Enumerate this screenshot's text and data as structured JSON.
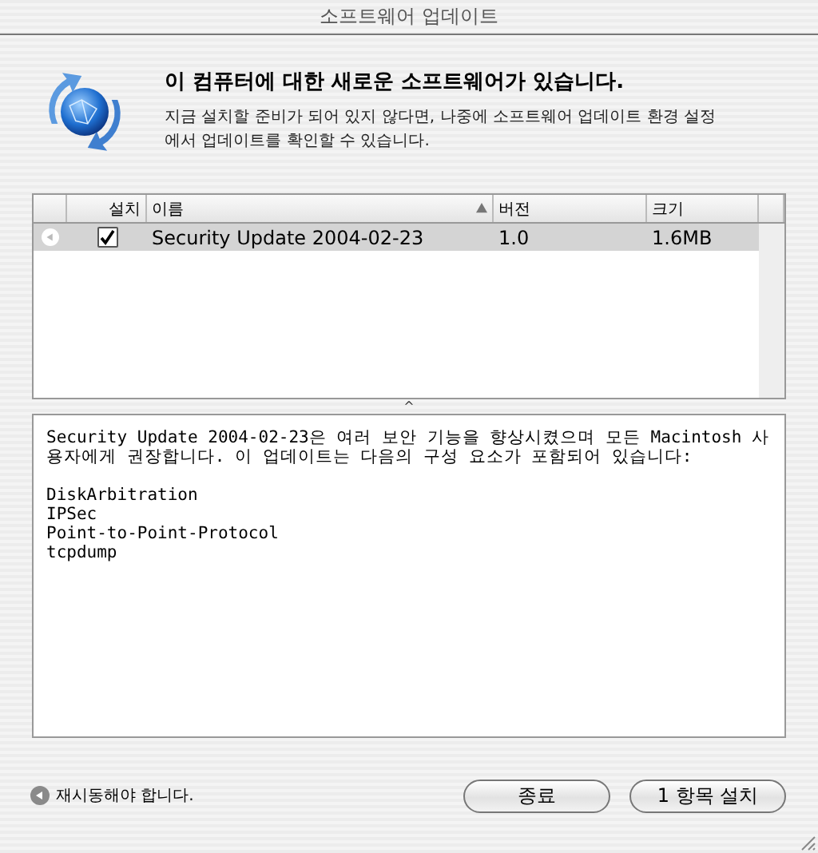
{
  "window": {
    "title": "소프트웨어 업데이트"
  },
  "header": {
    "heading": "이 컴퓨터에 대한 새로운 소프트웨어가 있습니다.",
    "message": "지금 설치할 준비가 되어 있지 않다면, 나중에 소프트웨어 업데이트 환경 설정에서 업데이트를 확인할 수 있습니다."
  },
  "table": {
    "columns": [
      {
        "label": "설치",
        "sorted": false
      },
      {
        "label": "이름",
        "sorted": true
      },
      {
        "label": "버전",
        "sorted": false
      },
      {
        "label": "크기",
        "sorted": false
      }
    ],
    "rows": [
      {
        "restart": true,
        "checked": true,
        "selected": true,
        "name": "Security Update 2004-02-23",
        "version": "1.0",
        "size": "1.6MB"
      }
    ]
  },
  "splitter": {
    "glyph": "^"
  },
  "description": {
    "text": "Security Update 2004-02-23은 여러 보안 기능을 향상시켰으며 모든 Macintosh 사용자에게 권장합니다. 이 업데이트는 다음의 구성 요소가 포함되어 있습니다:",
    "components": [
      "DiskArbitration",
      "IPSec",
      "Point-to-Point-Protocol",
      "tcpdump"
    ]
  },
  "footer": {
    "note": "재시동해야 합니다.",
    "buttons": [
      "종료",
      "1 항목 설치"
    ]
  }
}
